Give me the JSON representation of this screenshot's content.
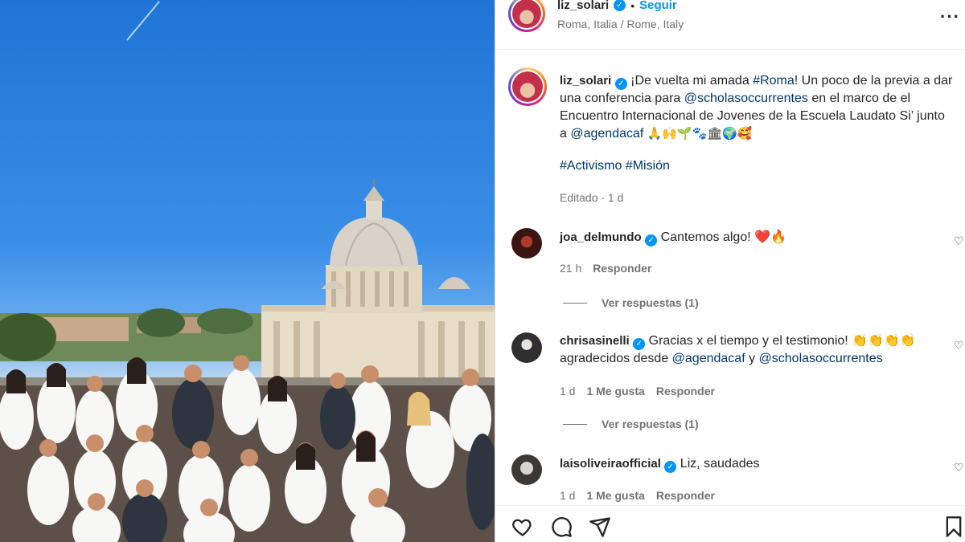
{
  "post": {
    "username": "liz_solari",
    "follow_label": "Seguir",
    "location": "Roma, Italia / Rome, Italy",
    "more_label": "···"
  },
  "caption": {
    "username": "liz_solari",
    "line1_text": "¡De vuelta mi amada ",
    "line1_tag": "#Roma",
    "line1_rest": "! Un poco de la previa a dar",
    "line2_text": "una conferencia para ",
    "line2_mention": "@scholasoccurrentes",
    "line2_rest": " en el marco de el",
    "line3": "Encuentro Internacional de Jovenes de la Escuela Laudato Si’ junto",
    "line4_text": "a ",
    "line4_mention": "@agendacaf",
    "line4_emojis": " 🙏🙌🌱🐾🏛🌍🥰",
    "hashtags": "#Activismo #Misión",
    "edited": "Editado · 1 d"
  },
  "comments": [
    {
      "username": "joa_delmundo",
      "text": "Cantemos algo! ❤️🔥",
      "time": "21 h",
      "likes": "",
      "reply_label": "Responder",
      "view_replies": "Ver respuestas (1)"
    },
    {
      "username": "chrisasinelli",
      "text": "Gracias x el tiempo y el testimonio! 👏👏👏👏",
      "line2_text": "agradecidos desde ",
      "line2_mention1": "@agendacaf",
      "line2_mid": " y ",
      "line2_mention2": "@scholasoccurrentes",
      "time": "1 d",
      "likes": "1 Me gusta",
      "reply_label": "Responder",
      "view_replies": "Ver respuestas (1)"
    },
    {
      "username": "laisoliveiraofficial",
      "text": "Liz, saudades",
      "time": "1 d",
      "likes": "1 Me gusta",
      "reply_label": "Responder"
    }
  ],
  "icons": {
    "like": "heart-icon",
    "comment": "comment-icon",
    "share": "share-icon",
    "save": "bookmark-icon",
    "verified": "verified-icon"
  },
  "colors": {
    "accent": "#0095f6",
    "link": "#00376b",
    "muted": "#737373"
  }
}
